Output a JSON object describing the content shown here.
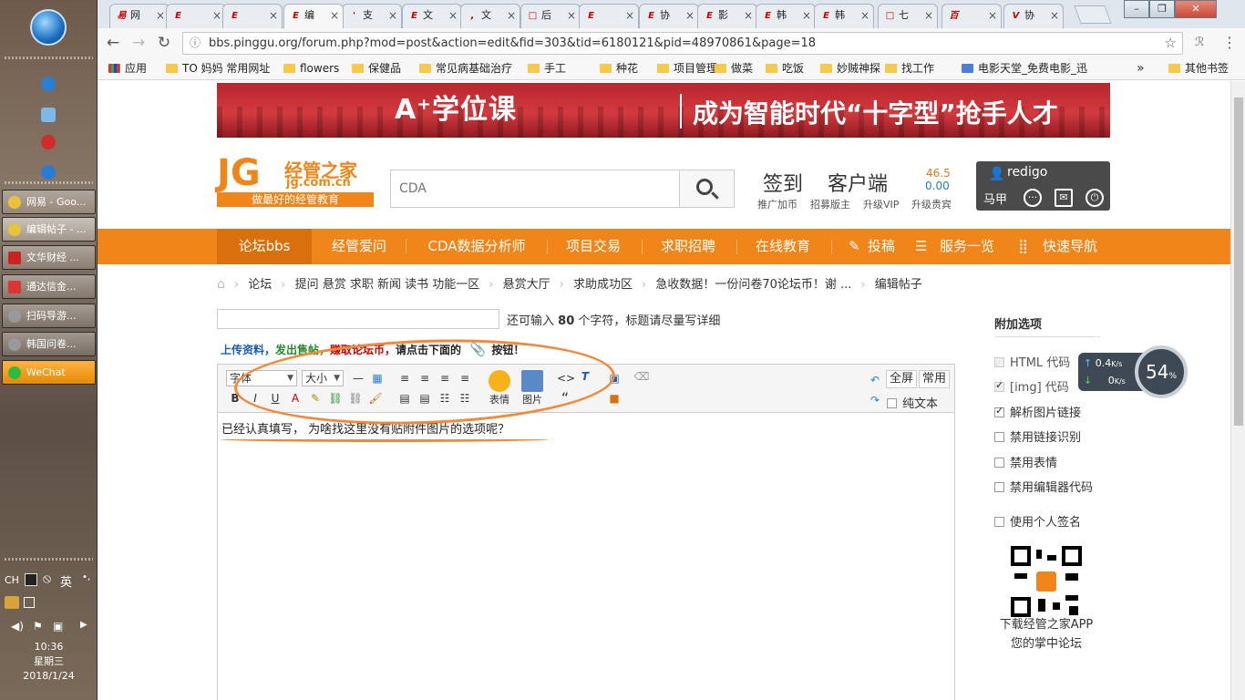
{
  "taskbar": {
    "items": [
      {
        "label": "网易 - Goo..."
      },
      {
        "label": "编辑帖子 - ..."
      },
      {
        "label": "文华财经 ..."
      },
      {
        "label": "通达信金..."
      },
      {
        "label": "扫码导游..."
      },
      {
        "label": "韩国问卷..."
      },
      {
        "label": "WeChat"
      }
    ],
    "tray_ime": "CH",
    "tray_lang": "英",
    "clock_time": "10:36",
    "clock_day": "星期三",
    "clock_date": "2018/1/24"
  },
  "browser": {
    "tabs": [
      {
        "label": "网",
        "fav": "易"
      },
      {
        "label": "",
        "fav": "E"
      },
      {
        "label": "",
        "fav": "E"
      },
      {
        "label": "编",
        "fav": "E"
      },
      {
        "label": "支",
        "fav": "'"
      },
      {
        "label": "文",
        "fav": "E"
      },
      {
        "label": "文",
        "fav": ","
      },
      {
        "label": "后",
        "fav": "□"
      },
      {
        "label": "",
        "fav": "E"
      },
      {
        "label": "协",
        "fav": "E"
      },
      {
        "label": "影",
        "fav": "E"
      },
      {
        "label": "韩",
        "fav": "E"
      },
      {
        "label": "韩",
        "fav": "E"
      },
      {
        "label": "七",
        "fav": "□"
      },
      {
        "label": "",
        "fav": "百"
      },
      {
        "label": "协",
        "fav": "V"
      }
    ],
    "url": "bbs.pinggu.org/forum.php?mod=post&action=edit&fid=303&tid=6180121&pid=48970861&page=18",
    "bookmarks": [
      "应用",
      "TO 妈妈 常用网址",
      "flowers",
      "保健品",
      "常见病基础治疗",
      "手工",
      "种花",
      "项目管理",
      "做菜",
      "吃饭",
      "妙贼神探",
      "找工作",
      "电影天堂_免费电影_迅"
    ],
    "bookmarks_more": "»",
    "other_bookmarks": "其他书签"
  },
  "site": {
    "banner_a": "A⁺学位课",
    "banner_b": "成为智能时代“十字型”抢手人才",
    "logo_jg": "JG",
    "logo_name": "经管之家",
    "logo_domain": "jg.com.cn",
    "logo_slogan": "做最好的经管教育",
    "search_placeholder": "CDA",
    "header_links": {
      "checkin": "签到",
      "client": "客户端"
    },
    "header_subs": [
      "推广加币",
      "招募版主",
      "升级VIP",
      "升级贵宾"
    ],
    "balance_1": "46.5",
    "balance_2": "0.00",
    "username": "redigo",
    "alias": "马甲"
  },
  "nav": [
    "论坛bbs",
    "经管爱问",
    "CDA数据分析师",
    "项目交易",
    "求职招聘",
    "在线教育",
    "投稿",
    "服务一览",
    "快速导航"
  ],
  "breadcrumb": [
    "论坛",
    "提问 悬赏 求职 新闻 读书 功能一区",
    "悬赏大厅",
    "求助成功区",
    "急收数据！一份问卷70论坛币！谢 ...",
    "编辑帖子"
  ],
  "form": {
    "title_hint_a": "还可输入",
    "title_hint_count": "80",
    "title_hint_b": "个字符，标题请尽量写详细",
    "upload_1": "上传资料，",
    "upload_2": "发出售帖，",
    "upload_3": "赚取论坛币，",
    "upload_4": "请点击下面的",
    "upload_5": "按钮！"
  },
  "editor": {
    "font_label": "字体",
    "size_label": "大小",
    "smiley_label": "表情",
    "image_label": "图片",
    "fullscreen_label": "全屏",
    "common_label": "常用",
    "plaintext_label": "纯文本",
    "content": "已经认真填写，  为啥找这里没有贴附件图片的选项呢？"
  },
  "sidebar": {
    "title": "附加选项",
    "options": [
      {
        "label": "HTML 代码"
      },
      {
        "label": "[img] 代码"
      },
      {
        "label": "解析图片链接"
      },
      {
        "label": "禁用链接识别"
      },
      {
        "label": "禁用表情"
      },
      {
        "label": "禁用编辑器代码"
      },
      {
        "label": "使用个人签名"
      }
    ],
    "qr_line1": "下载经管之家APP",
    "qr_line2": "您的掌中论坛"
  },
  "net_widget": {
    "up": "0.4",
    "up_unit": "K/s",
    "down": "0",
    "down_unit": "K/s",
    "percent": "54",
    "percent_unit": "%"
  }
}
